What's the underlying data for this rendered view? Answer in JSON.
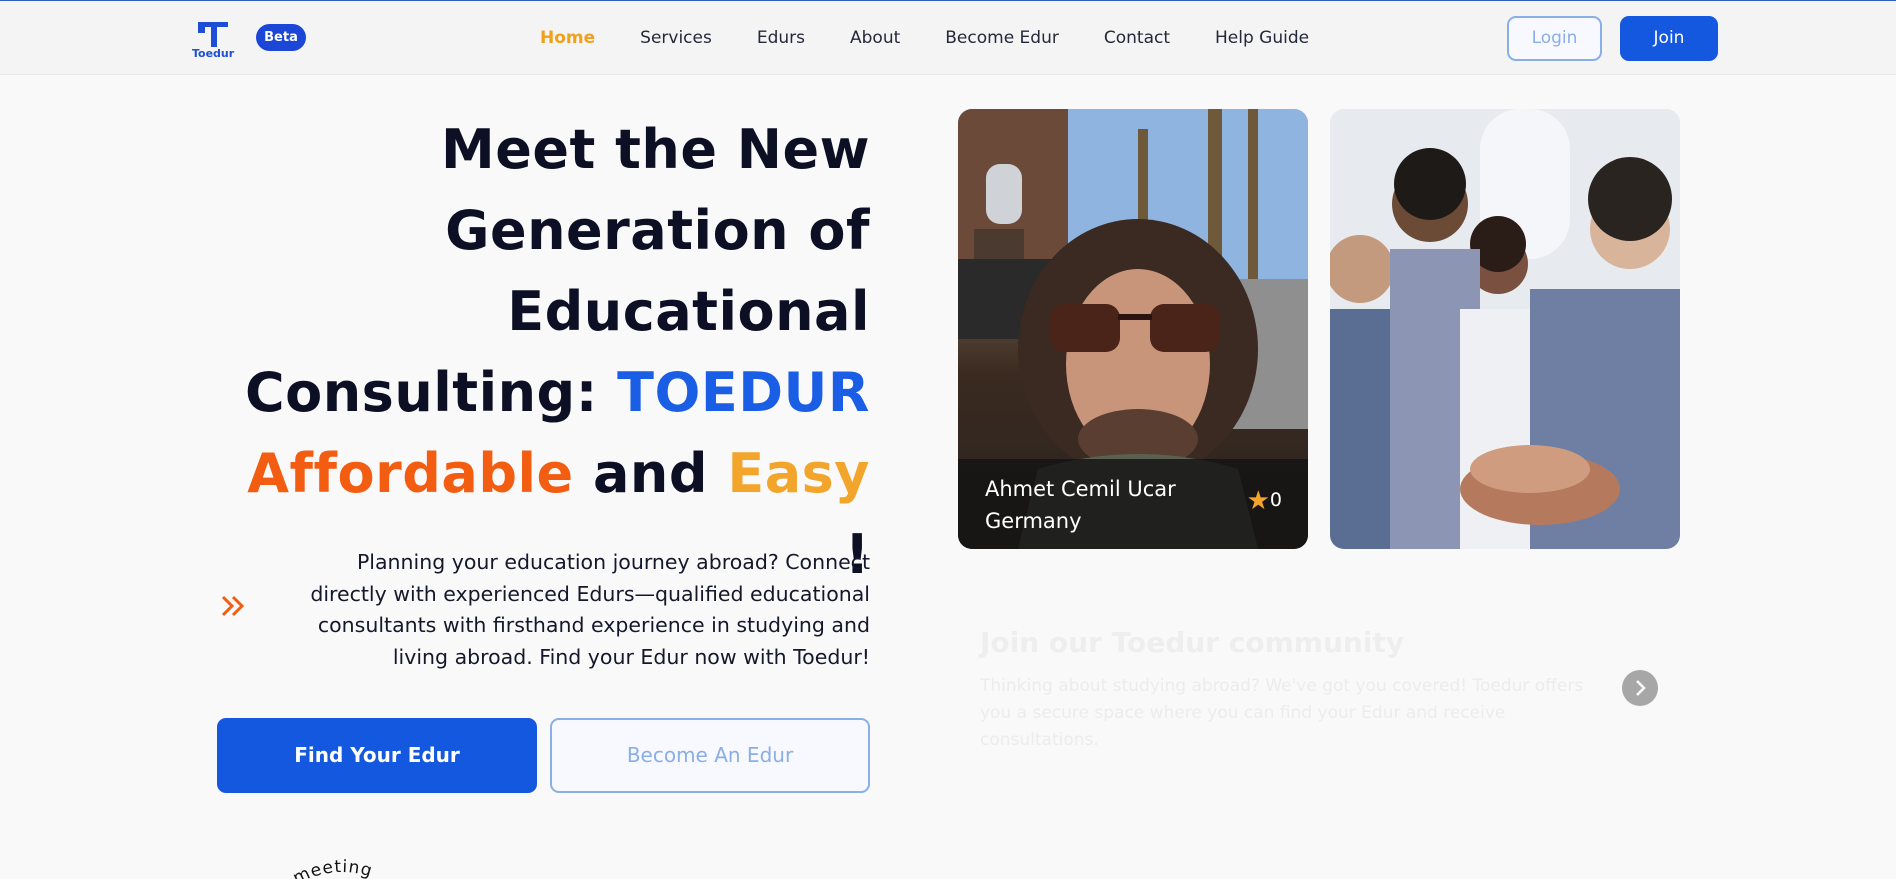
{
  "brand": {
    "logo_text": "Toedur",
    "badge": "Beta"
  },
  "nav": {
    "items": [
      {
        "label": "Home",
        "active": true
      },
      {
        "label": "Services"
      },
      {
        "label": "Edurs"
      },
      {
        "label": "About"
      },
      {
        "label": "Become Edur"
      },
      {
        "label": "Contact"
      },
      {
        "label": "Help Guide"
      }
    ],
    "login_label": "Login",
    "join_label": "Join"
  },
  "hero": {
    "title_line1": "Meet the New",
    "title_line2": "Generation of",
    "title_line3": "Educational",
    "title_line4_prefix": "Consulting:",
    "title_brand": "TOEDUR",
    "title_word_affordable": "Affordable",
    "title_word_and": "and",
    "title_word_easy": "Easy",
    "title_exclaim": "!",
    "description": "Planning your education journey abroad? Connect directly with experienced Edurs—qualified educational consultants with firsthand experience in studying and living abroad. Find your Edur now with Toedur!",
    "find_button": "Find Your Edur",
    "become_button": "Become An Edur",
    "circular_text": "ee meeting"
  },
  "edur_card": {
    "name": "Ahmet Cemil Ucar",
    "country": "Germany",
    "rating": "0",
    "rating_icon": "star-icon"
  },
  "community": {
    "title": "Join our Toedur community",
    "description": "Thinking about studying abroad? We've got you covered! Toedur offers you a secure space where you can find your Edur and receive consultations."
  },
  "colors": {
    "primary": "#1558e0",
    "accent_orange": "#f25d12",
    "accent_yellow": "#f2a52a",
    "nav_active": "#f2a019"
  }
}
